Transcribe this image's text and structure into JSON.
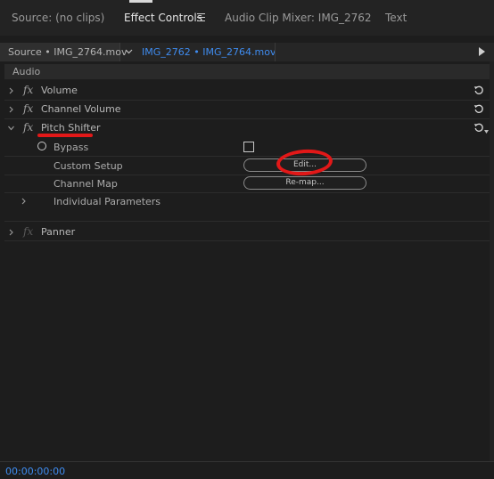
{
  "tabs": [
    {
      "label": "Source: (no clips)"
    },
    {
      "label": "Effect Controls"
    },
    {
      "label": "Audio Clip Mixer: IMG_2762"
    },
    {
      "label": "Text"
    }
  ],
  "clip_bar": {
    "source": "Source • IMG_2764.mov",
    "clip": "IMG_2762 • IMG_2764.mov"
  },
  "section": {
    "label": "Audio"
  },
  "effects": {
    "volume": {
      "fx": "fx",
      "label": "Volume"
    },
    "channel_volume": {
      "fx": "fx",
      "label": "Channel Volume"
    },
    "pitch_shifter": {
      "fx": "fx",
      "label": "Pitch Shifter"
    },
    "panner": {
      "fx": "fx",
      "label": "Panner"
    }
  },
  "params": {
    "bypass": {
      "label": "Bypass",
      "checked": false
    },
    "custom_setup": {
      "label": "Custom Setup",
      "button": "Edit..."
    },
    "channel_map": {
      "label": "Channel Map",
      "button": "Re-map..."
    },
    "individual": {
      "label": "Individual Parameters"
    }
  },
  "timecode": "00:00:00:00",
  "colors": {
    "accent_blue": "#3f8cf0",
    "annotation_red": "#e21818"
  }
}
